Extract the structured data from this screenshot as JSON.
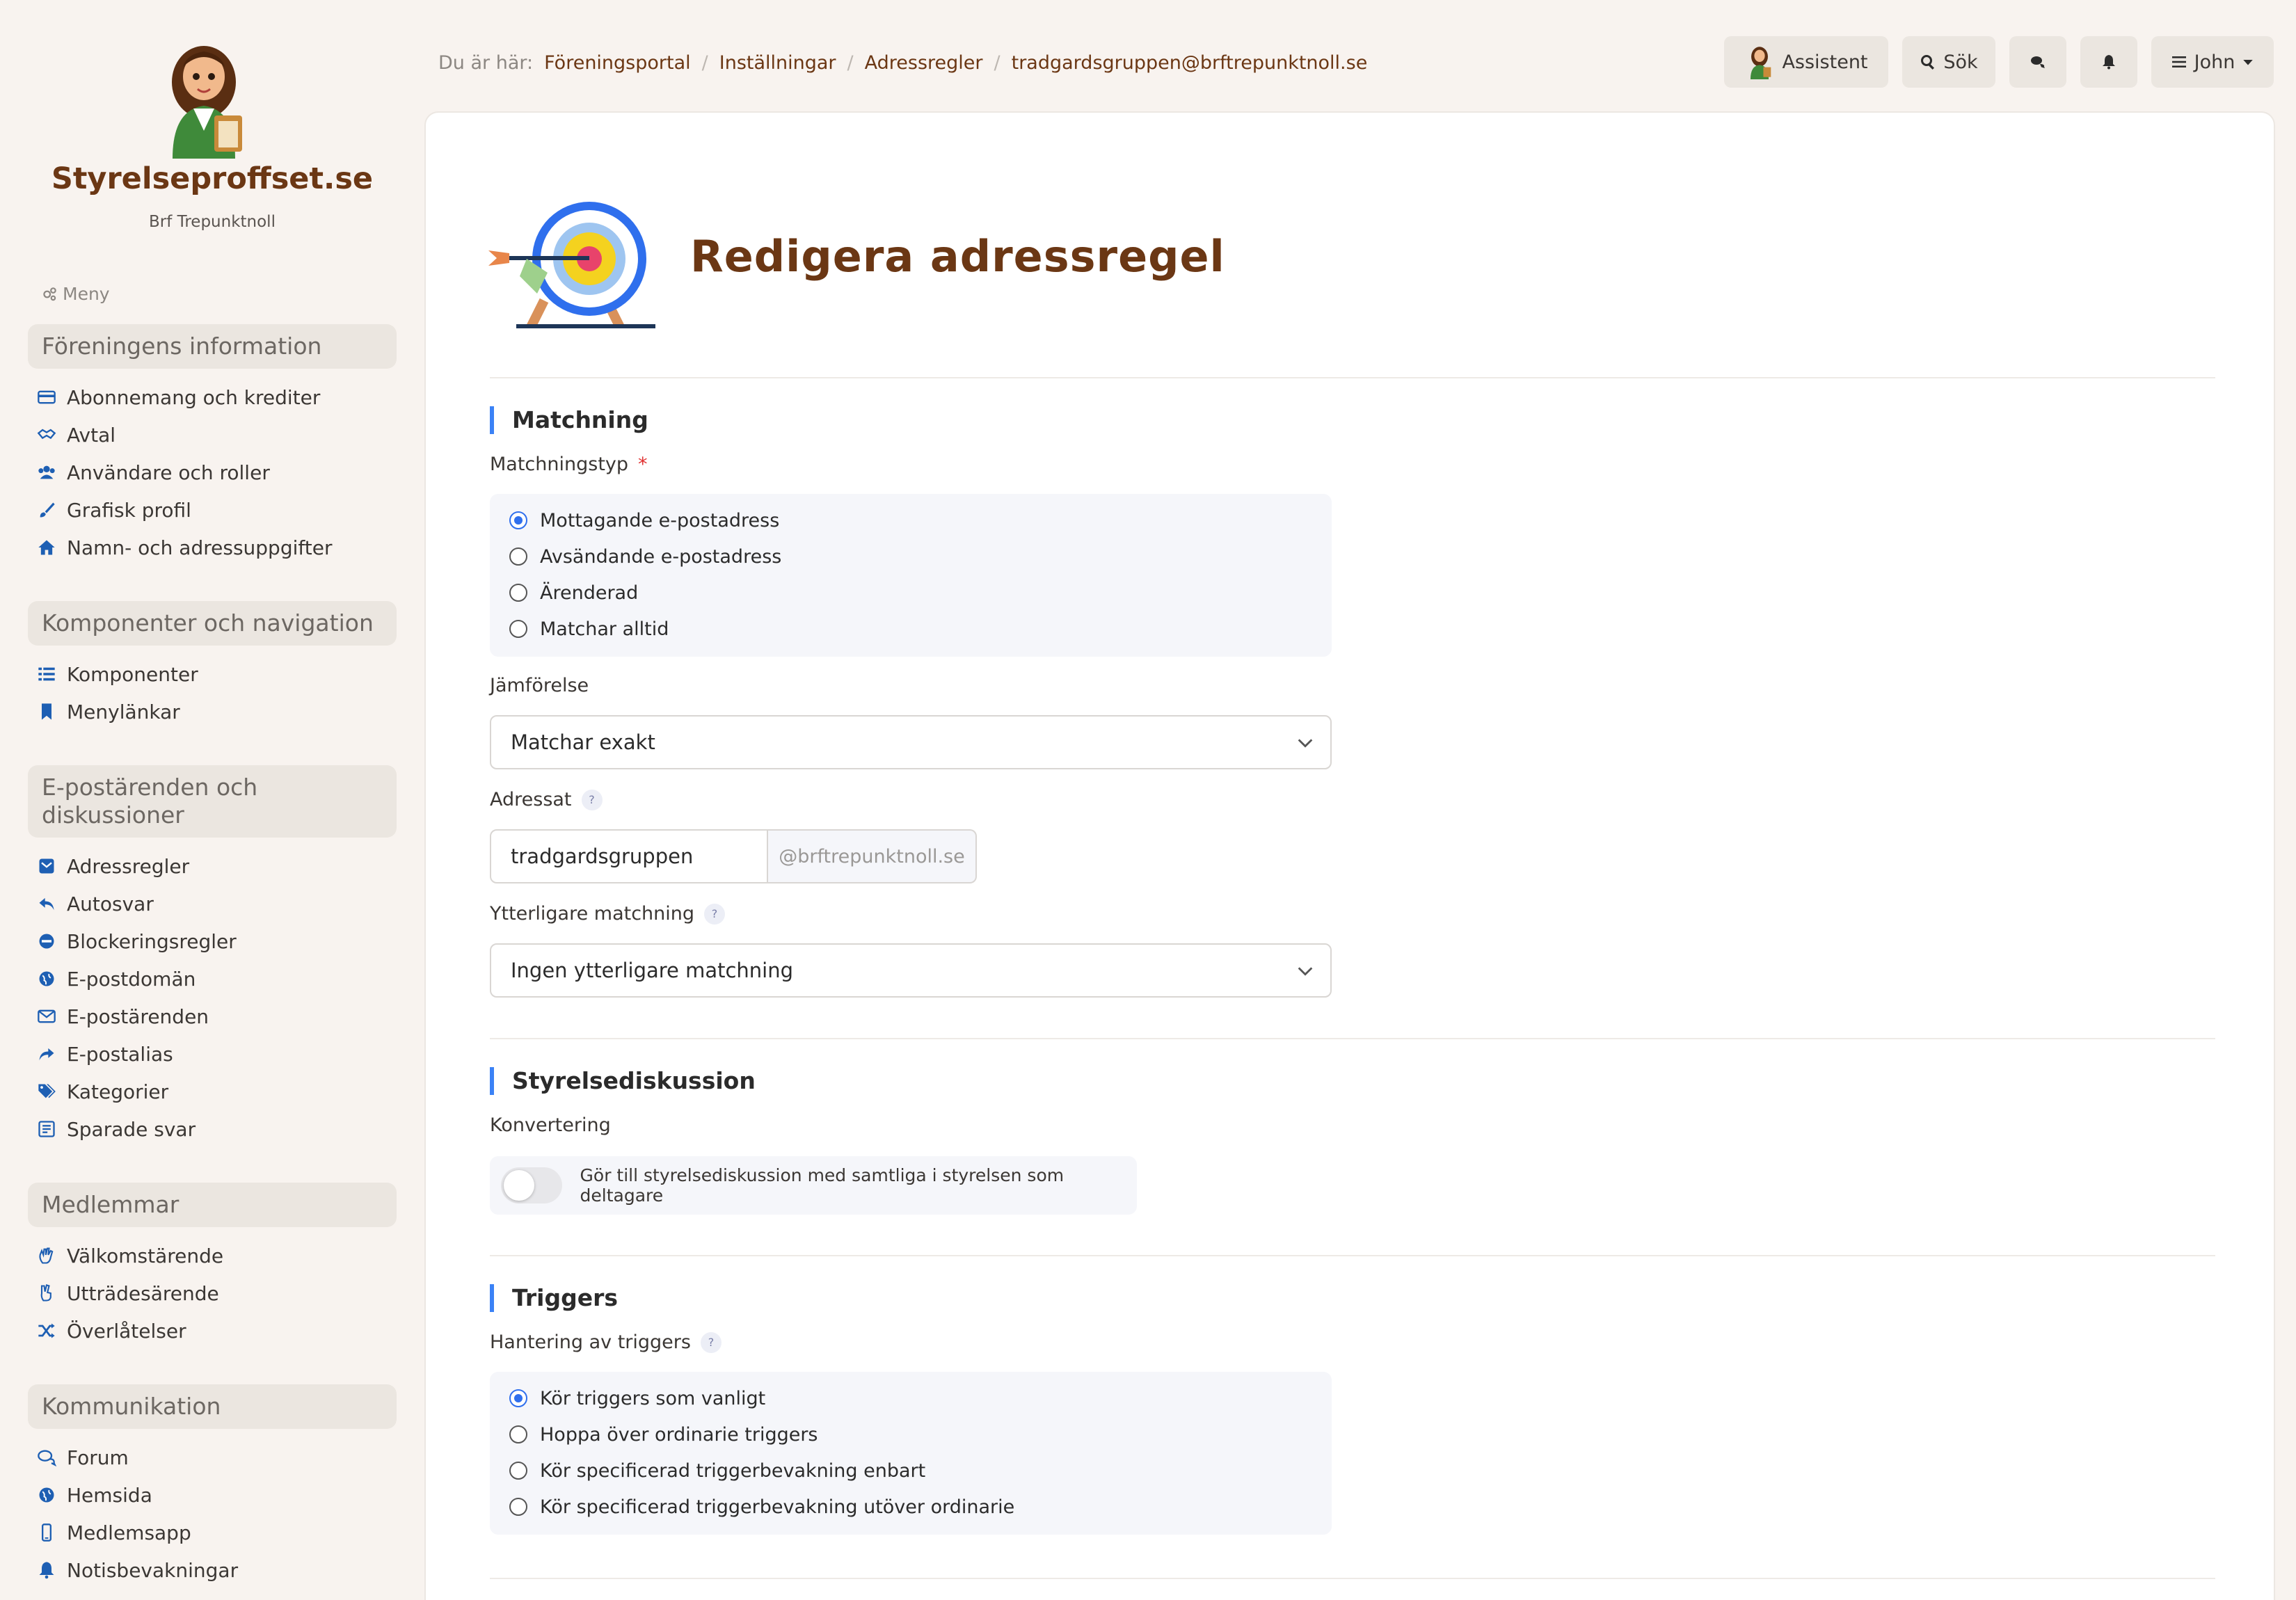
{
  "sidebar": {
    "brand": "Styrelseproffset.se",
    "org": "Brf Trepunktnoll",
    "menu_caption": "Meny",
    "groups": [
      {
        "title": "Föreningens information",
        "items": [
          "Abonnemang och krediter",
          "Avtal",
          "Användare och roller",
          "Grafisk profil",
          "Namn- och adressuppgifter"
        ]
      },
      {
        "title": "Komponenter och navigation",
        "items": [
          "Komponenter",
          "Menylänkar"
        ]
      },
      {
        "title": "E-postärenden och diskussioner",
        "items": [
          "Adressregler",
          "Autosvar",
          "Blockeringsregler",
          "E-postdomän",
          "E-postärenden",
          "E-postalias",
          "Kategorier",
          "Sparade svar"
        ]
      },
      {
        "title": "Medlemmar",
        "items": [
          "Välkomstärende",
          "Utträdesärende",
          "Överlåtelser"
        ]
      },
      {
        "title": "Kommunikation",
        "items": [
          "Forum",
          "Hemsida",
          "Medlemsapp",
          "Notisbevakningar"
        ]
      }
    ]
  },
  "breadcrumb": {
    "lead": "Du är här:",
    "crumbs": [
      "Föreningsportal",
      "Inställningar",
      "Adressregler",
      "tradgardsgruppen@brftrepunktnoll.se"
    ]
  },
  "topbar": {
    "assistant": "Assistent",
    "search": "Sök",
    "user": "John"
  },
  "page": {
    "title": "Redigera adressregel"
  },
  "matching": {
    "section": "Matchning",
    "type_label": "Matchningstyp",
    "required_mark": "*",
    "type_options": [
      "Mottagande e-postadress",
      "Avsändande e-postadress",
      "Ärenderad",
      "Matchar alltid"
    ],
    "type_selected": 0,
    "comparison_label": "Jämförelse",
    "comparison_value": "Matchar exakt",
    "address_label": "Adressat",
    "address_value": "tradgardsgruppen",
    "address_domain": "@brftrepunktnoll.se",
    "extra_label": "Ytterligare matchning",
    "extra_value": "Ingen ytterligare matchning",
    "help_glyph": "?"
  },
  "discussion": {
    "section": "Styrelsediskussion",
    "conversion_label": "Konvertering",
    "toggle_text": "Gör till styrelsediskussion med samtliga i styrelsen som deltagare",
    "toggle_on": false
  },
  "triggers": {
    "section": "Triggers",
    "handling_label": "Hantering av triggers",
    "options": [
      "Kör triggers som vanligt",
      "Hoppa över ordinarie triggers",
      "Kör specificerad triggerbevakning enbart",
      "Kör specificerad triggerbevakning utöver ordinarie"
    ],
    "selected": 0
  },
  "colors": {
    "brand": "#6b3714",
    "accent": "#3b82f6",
    "radio_selected": "#2f6fed"
  }
}
